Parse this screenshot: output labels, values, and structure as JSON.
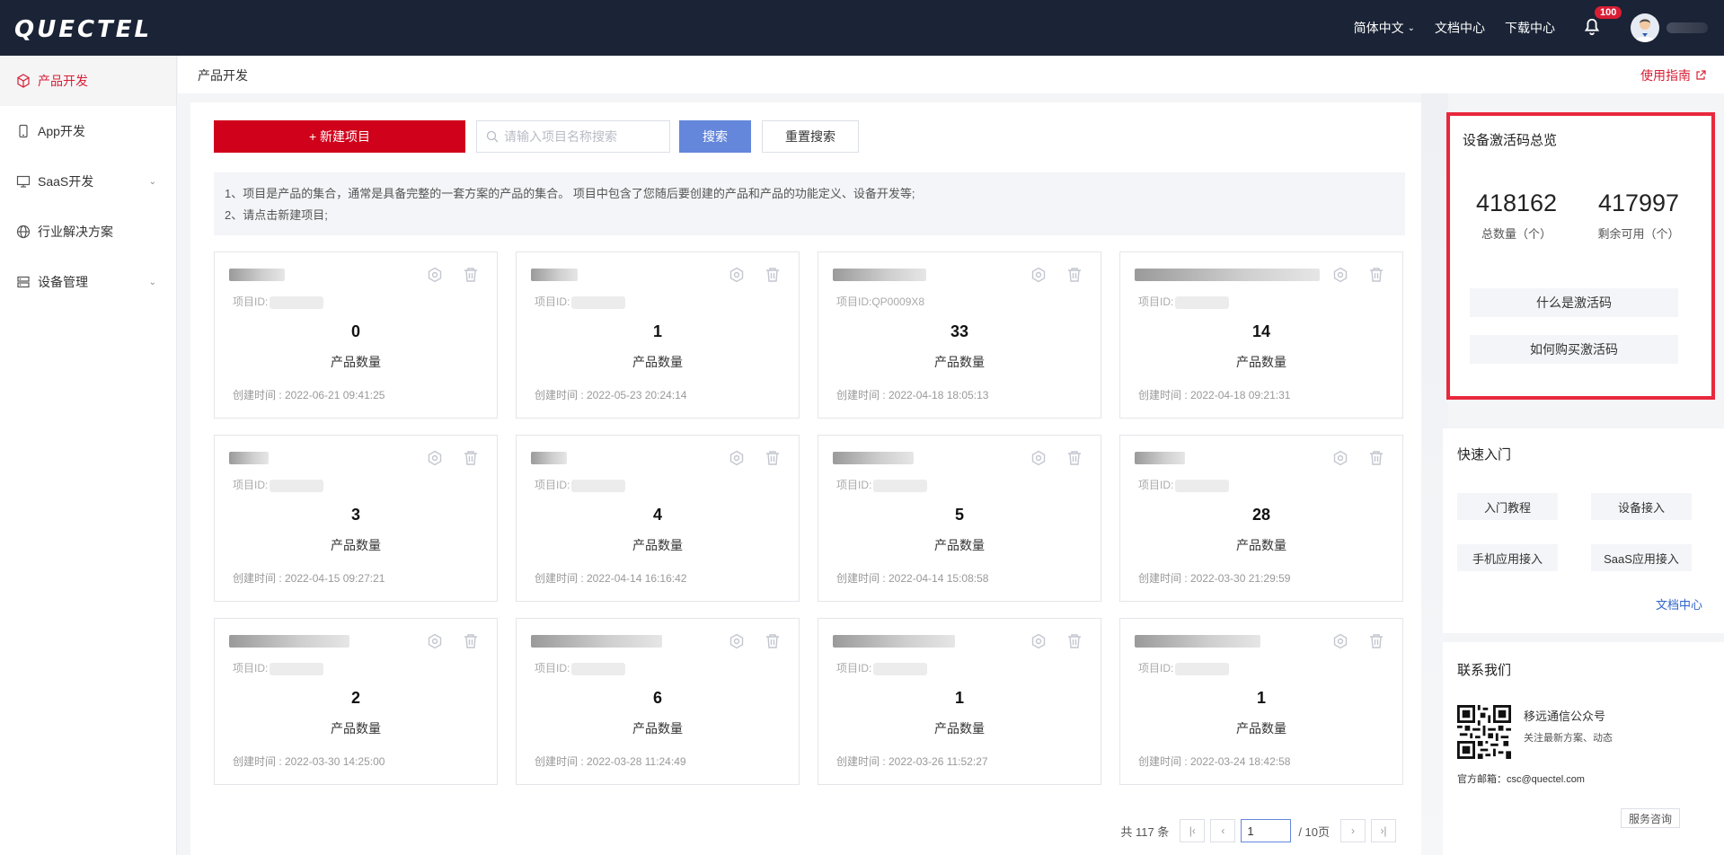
{
  "app": {
    "logo_text": "QUECTEL"
  },
  "topnav": {
    "language": "简体中文",
    "docs": "文档中心",
    "downloads": "下载中心",
    "notification_count": "100"
  },
  "sidebar": {
    "items": [
      {
        "label": "产品开发",
        "icon": "cube-icon",
        "active": true
      },
      {
        "label": "App开发",
        "icon": "phone-icon"
      },
      {
        "label": "SaaS开发",
        "icon": "monitor-icon",
        "expandable": true
      },
      {
        "label": "行业解决方案",
        "icon": "globe-icon"
      },
      {
        "label": "设备管理",
        "icon": "device-icon",
        "expandable": true
      }
    ]
  },
  "header": {
    "breadcrumb": "产品开发",
    "guide_link": "使用指南"
  },
  "toolbar": {
    "new_project_label": "+ 新建项目",
    "search_placeholder": "请输入项目名称搜索",
    "search_label": "搜索",
    "reset_label": "重置搜索"
  },
  "info": {
    "line1": "1、项目是产品的集合，通常是具备完整的一套方案的产品的集合。 项目中包含了您随后要创建的产品和产品的功能定义、设备开发等;",
    "line2": "2、请点击新建项目;"
  },
  "projects": [
    {
      "pid_label": "项目ID:",
      "count": "0",
      "count_label": "产品数量",
      "created": "创建时间 : 2022-06-21 09:41:25"
    },
    {
      "pid_label": "项目ID:",
      "count": "1",
      "count_label": "产品数量",
      "created": "创建时间 : 2022-05-23 20:24:14"
    },
    {
      "pid_label": "项目ID:QP0009X8",
      "count": "33",
      "count_label": "产品数量",
      "created": "创建时间 : 2022-04-18 18:05:13"
    },
    {
      "pid_label": "项目ID:",
      "count": "14",
      "count_label": "产品数量",
      "created": "创建时间 : 2022-04-18 09:21:31"
    },
    {
      "pid_label": "项目ID:",
      "count": "3",
      "count_label": "产品数量",
      "created": "创建时间 : 2022-04-15 09:27:21"
    },
    {
      "pid_label": "项目ID:",
      "count": "4",
      "count_label": "产品数量",
      "created": "创建时间 : 2022-04-14 16:16:42"
    },
    {
      "pid_label": "项目ID:",
      "count": "5",
      "count_label": "产品数量",
      "created": "创建时间 : 2022-04-14 15:08:58"
    },
    {
      "pid_label": "项目ID:",
      "count": "28",
      "count_label": "产品数量",
      "created": "创建时间 : 2022-03-30 21:29:59"
    },
    {
      "pid_label": "项目ID:",
      "count": "2",
      "count_label": "产品数量",
      "created": "创建时间 : 2022-03-30 14:25:00"
    },
    {
      "pid_label": "项目ID:",
      "count": "6",
      "count_label": "产品数量",
      "created": "创建时间 : 2022-03-28 11:24:49"
    },
    {
      "pid_label": "项目ID:",
      "count": "1",
      "count_label": "产品数量",
      "created": "创建时间 : 2022-03-26 11:52:27"
    },
    {
      "pid_label": "项目ID:",
      "count": "1",
      "count_label": "产品数量",
      "created": "创建时间 : 2022-03-24 18:42:58"
    }
  ],
  "pagination": {
    "total": "共 117 条",
    "current": "1",
    "pages": "/ 10页"
  },
  "activation": {
    "title": "设备激活码总览",
    "total": "418162",
    "total_label": "总数量（个）",
    "remaining": "417997",
    "remaining_label": "剩余可用（个）",
    "what_btn": "什么是激活码",
    "buy_btn": "如何购买激活码"
  },
  "quick_start": {
    "title": "快速入门",
    "buttons": [
      "入门教程",
      "设备接入",
      "手机应用接入",
      "SaaS应用接入"
    ],
    "doc_link": "文档中心"
  },
  "contact": {
    "title": "联系我们",
    "wechat_title": "移远通信公众号",
    "wechat_sub": "关注最新方案、动态",
    "email": "官方邮箱：csc@quectel.com",
    "service_btn": "服务咨询"
  },
  "colors": {
    "brand": "#d0021b",
    "topbar": "#1b2436",
    "search_btn": "#6487db",
    "link": "#2f64c9"
  }
}
